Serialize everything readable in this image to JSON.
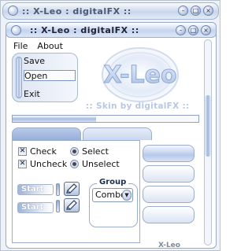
{
  "window": {
    "outer_title": ":: X-Leo : digitalFX ::",
    "inner_title": ":: X-Leo : digitalFX ::",
    "buttons": [
      "minimize",
      "maximize",
      "close"
    ]
  },
  "menu": {
    "items": [
      "File",
      "About"
    ]
  },
  "list": {
    "items": [
      "Save",
      "Open",
      "Exit"
    ],
    "selected": "Open"
  },
  "logo": {
    "text": "X-Leo"
  },
  "skin_caption": ":: Skin by digitalFX ::",
  "progress": {
    "value": 0.45
  },
  "tabs": [
    {
      "active": true
    },
    {
      "active": false
    }
  ],
  "checkboxes": [
    {
      "label": "Check",
      "checked": true
    },
    {
      "label": "Uncheck",
      "checked": true
    }
  ],
  "radios": [
    {
      "label": "Select"
    },
    {
      "label": "Unselect"
    }
  ],
  "start_buttons": [
    {
      "label": "Start"
    },
    {
      "label": "Start"
    }
  ],
  "group": {
    "legend": "Group",
    "combo_value": "Combo"
  },
  "status_text": "X-Leo",
  "icons": {
    "scroll": "scroll-thumb",
    "tool": "pencil-icon",
    "drop": "chevron-down-icon"
  }
}
